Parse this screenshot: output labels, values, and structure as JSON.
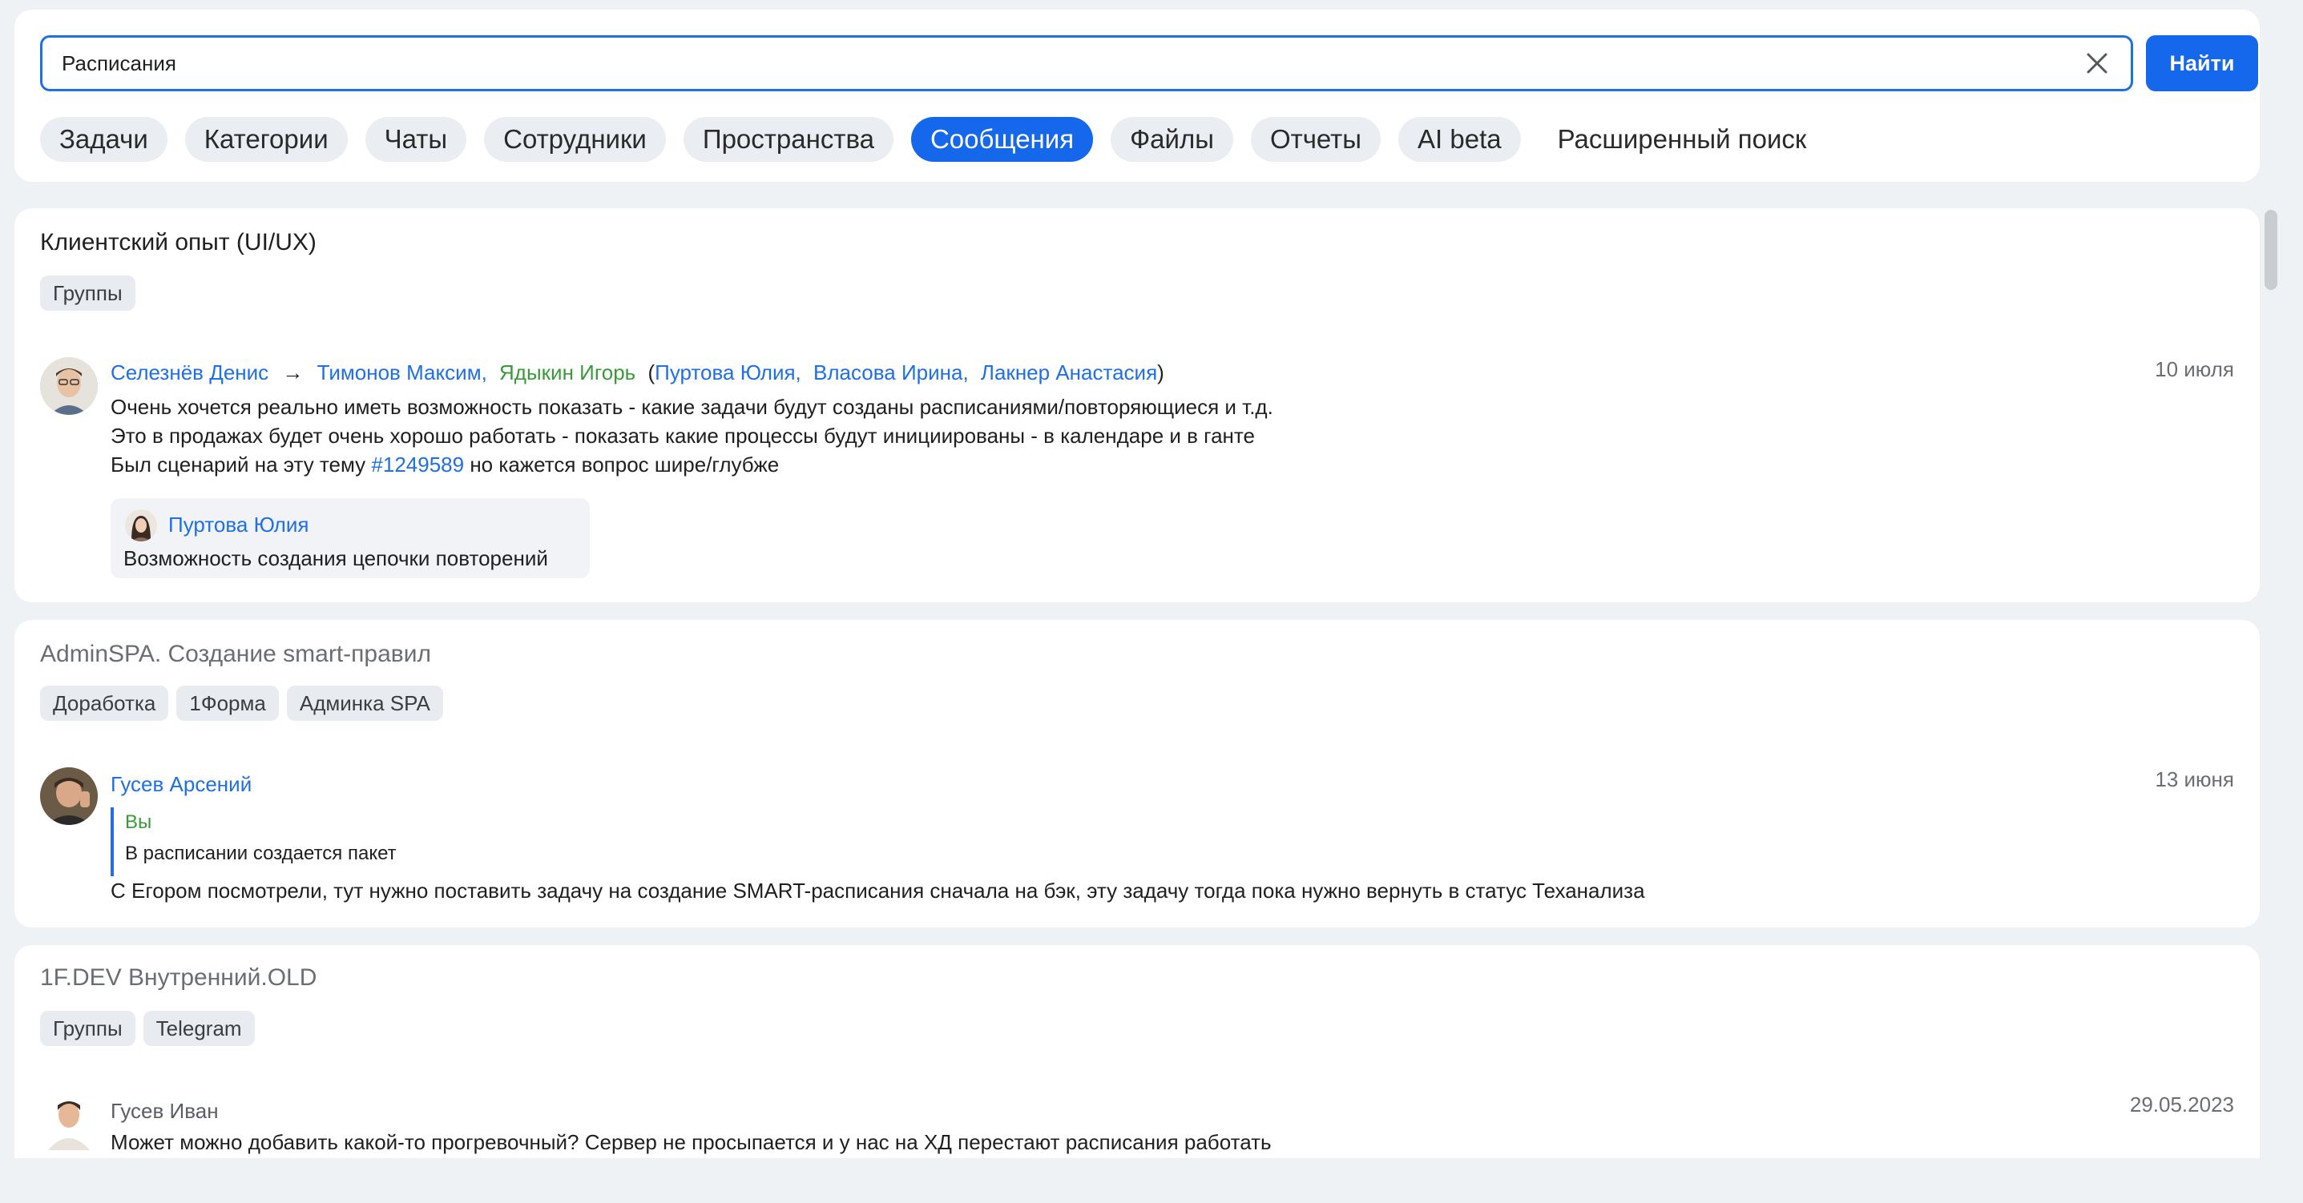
{
  "search": {
    "value": "Расписания",
    "button_label": "Найти"
  },
  "filters": {
    "chips": [
      "Задачи",
      "Категории",
      "Чаты",
      "Сотрудники",
      "Пространства",
      "Сообщения",
      "Файлы",
      "Отчеты",
      "AI beta"
    ],
    "active": "Сообщения",
    "advanced_label": "Расширенный поиск"
  },
  "results": [
    {
      "title": "Клиентский опыт (UI/UX)",
      "tags": [
        "Группы"
      ],
      "message": {
        "author": "Селезнёв Денис",
        "arrow": "→",
        "recipients": [
          "Тимонов Максим,",
          "Ядыкин Игорь"
        ],
        "paren_open": "(",
        "cc": [
          "Пуртова Юлия,",
          "Власова Ирина,",
          "Лакнер Анастасия"
        ],
        "paren_close": ")",
        "date": "10 июля",
        "lines": [
          "Очень хочется реально иметь возможность показать - какие задачи будут созданы расписаниями/повторяющиеся и т.д.",
          "Это в продажах будет очень хорошо работать - показать какие процессы будут инициированы - в календаре и в ганте"
        ],
        "line3_prefix": "Был сценарий на эту тему",
        "line3_link": "#1249589",
        "line3_suffix": "но кажется вопрос шире/глубже",
        "reply": {
          "author": "Пуртова Юлия",
          "text": "Возможность создания цепочки повторений"
        }
      }
    },
    {
      "title": "AdminSPA. Создание smart-правил",
      "tags": [
        "Доработка",
        "1Форма",
        "Админка SPA"
      ],
      "message": {
        "author": "Гусев Арсений",
        "date": "13 июня",
        "quote_author": "Вы",
        "quote_text": "В расписании создается пакет",
        "text": "С Егором посмотрели, тут нужно поставить задачу на создание SMART-расписания сначала на бэк, эту задачу тогда пока нужно вернуть в статус Теханализа"
      }
    },
    {
      "title": "1F.DEV Внутренний.OLD",
      "tags": [
        "Группы",
        "Telegram"
      ],
      "message": {
        "author": "Гусев Иван",
        "date": "29.05.2023",
        "text": "Может можно добавить какой-то прогревочный? Сервер не просыпается и у нас на ХД перестают расписания работать"
      }
    }
  ],
  "colors": {
    "accent": "#1567eb",
    "link": "#1f6fe5",
    "green": "#3a9a3a",
    "background": "#eff2f5"
  },
  "icons": {
    "clear": "close-icon",
    "arrow": "arrow-right-icon"
  }
}
